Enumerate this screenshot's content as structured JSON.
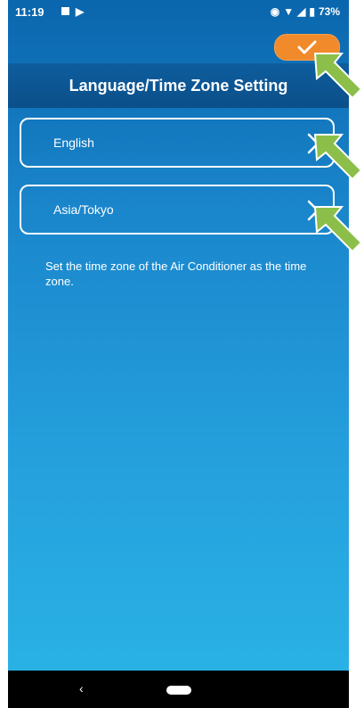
{
  "status_bar": {
    "time": "11:19",
    "battery": "73%"
  },
  "header": {
    "title": "Language/Time Zone Setting"
  },
  "confirm_button": {
    "icon": "check-icon"
  },
  "settings": [
    {
      "label": "English",
      "icon": "chevron-right-icon"
    },
    {
      "label": "Asia/Tokyo",
      "icon": "chevron-right-icon"
    }
  ],
  "description": "Set the time zone of the Air Conditioner as the time zone.",
  "colors": {
    "accent_orange": "#f08a2a",
    "header_blue": "#0b4f89",
    "annotation_green": "#8bbf4a"
  }
}
